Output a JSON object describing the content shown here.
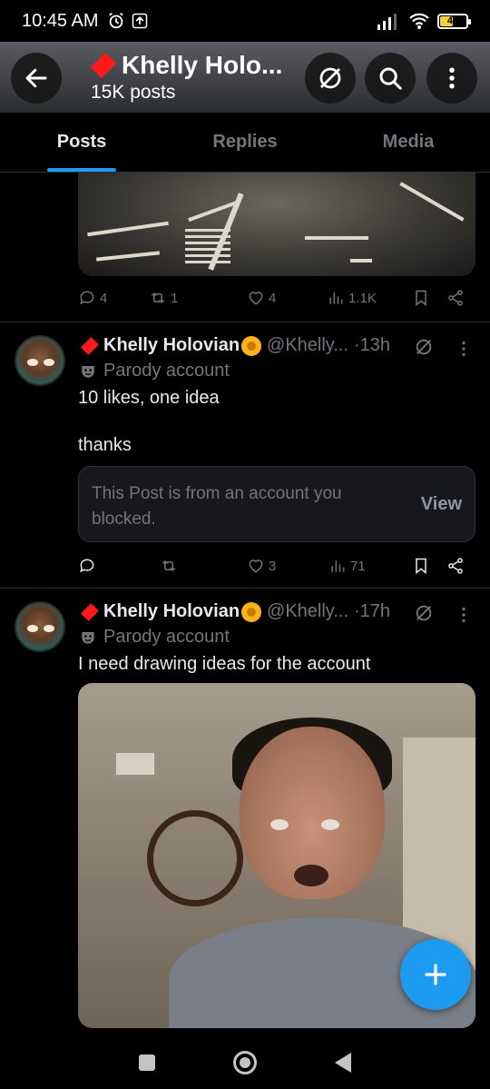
{
  "status_bar": {
    "time": "10:45 AM",
    "battery": "46"
  },
  "header": {
    "title": "Khelly Holo...",
    "posts_count": "15K posts"
  },
  "tabs": [
    {
      "label": "Posts",
      "active": true
    },
    {
      "label": "Replies",
      "active": false
    },
    {
      "label": "Media",
      "active": false
    }
  ],
  "top_post": {
    "replies": "4",
    "reposts": "1",
    "likes": "4",
    "views": "1.1K"
  },
  "posts": [
    {
      "name": "Khelly Holovian",
      "handle": "@Khelly...",
      "time": "·13h",
      "parody_label": "Parody account",
      "text": "10 likes, one idea\n\nthanks",
      "blocked_notice": "This Post is from an account you blocked.",
      "view_label": "View",
      "replies": "",
      "reposts": "",
      "likes": "3",
      "views": "71"
    },
    {
      "name": "Khelly Holovian",
      "handle": "@Khelly...",
      "time": "·17h",
      "parody_label": "Parody account",
      "text": "I need drawing ideas for the account"
    }
  ],
  "colors": {
    "accent": "#1d9bf0",
    "background": "#000000",
    "muted": "#71767b",
    "brand_diamond": "#ff1a1a"
  },
  "icons": [
    "back-arrow-icon",
    "parody-icon",
    "search-icon",
    "more-vertical-icon",
    "reply-icon",
    "repost-icon",
    "like-icon",
    "views-icon",
    "bookmark-icon",
    "share-icon",
    "compose-plus-icon"
  ]
}
